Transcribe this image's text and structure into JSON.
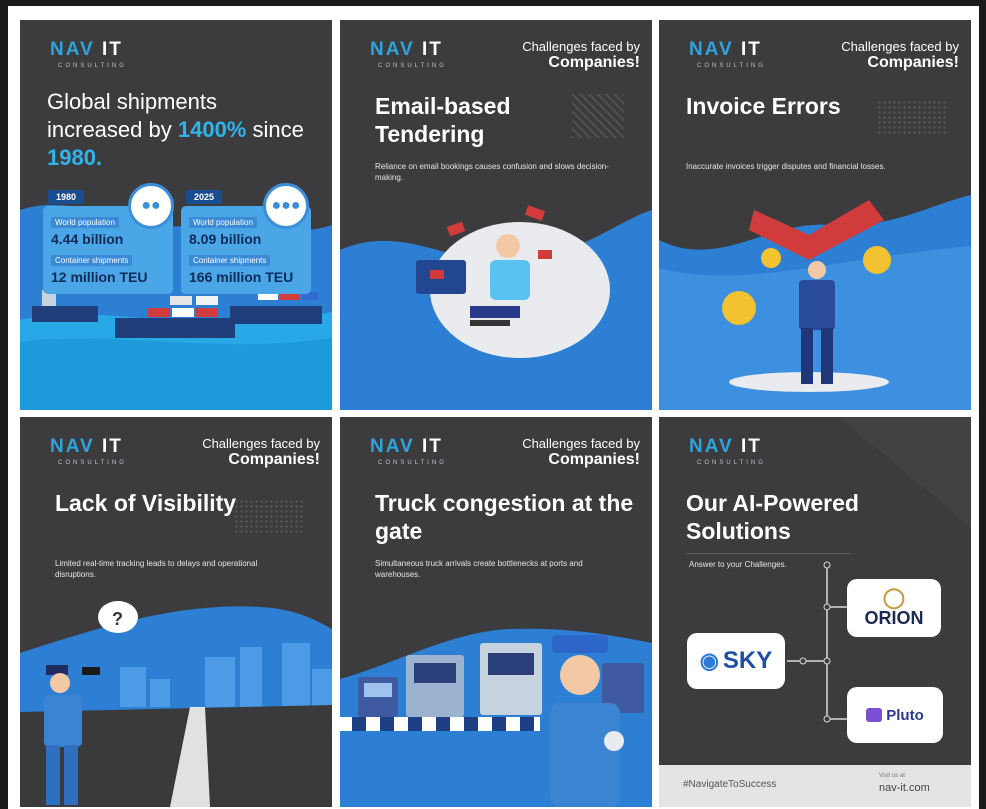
{
  "brand": {
    "logo_main": "NAV",
    "logo_it": "IT",
    "logo_sub": "CONSULTING"
  },
  "challenges": {
    "line1": "Challenges faced by",
    "line2": "Companies!"
  },
  "panel1": {
    "title_pre": "Global shipments increased by ",
    "title_highlight": "1400%",
    "title_mid": " since ",
    "title_year": "1980.",
    "left": {
      "year": "1980",
      "pop_label": "World population",
      "pop_value": "4.44 billion",
      "ship_label": "Container shipments",
      "ship_value": "12 million TEU"
    },
    "right": {
      "year": "2025",
      "pop_label": "World population",
      "pop_value": "8.09 billion",
      "ship_label": "Container shipments",
      "ship_value": "166 million TEU"
    }
  },
  "panel2": {
    "title": "Email-based Tendering",
    "desc": "Reliance on email bookings causes confusion and slows decision-making."
  },
  "panel3": {
    "title": "Invoice Errors",
    "desc": "Inaccurate invoices trigger disputes and financial losses."
  },
  "panel4": {
    "title": "Lack of Visibility",
    "desc": "Limited real-time tracking leads to delays and operational disruptions."
  },
  "panel5": {
    "title": "Truck congestion at the gate",
    "desc": "Simultaneous truck arrivals create bottlenecks at ports and warehouses."
  },
  "panel6": {
    "title": "Our AI-Powered Solutions",
    "desc": "Answer to your Challenges.",
    "products": {
      "orion": "ORION",
      "sky": "SKY",
      "pluto": "Pluto"
    },
    "footer_tag": "#NavigateToSuccess",
    "visit_label": "Visit us at",
    "url": "nav-it.com"
  },
  "colors": {
    "panel_bg": "#3c3c3f",
    "accent_blue": "#2fa3dc",
    "wave_blue": "#2d7fd4"
  }
}
